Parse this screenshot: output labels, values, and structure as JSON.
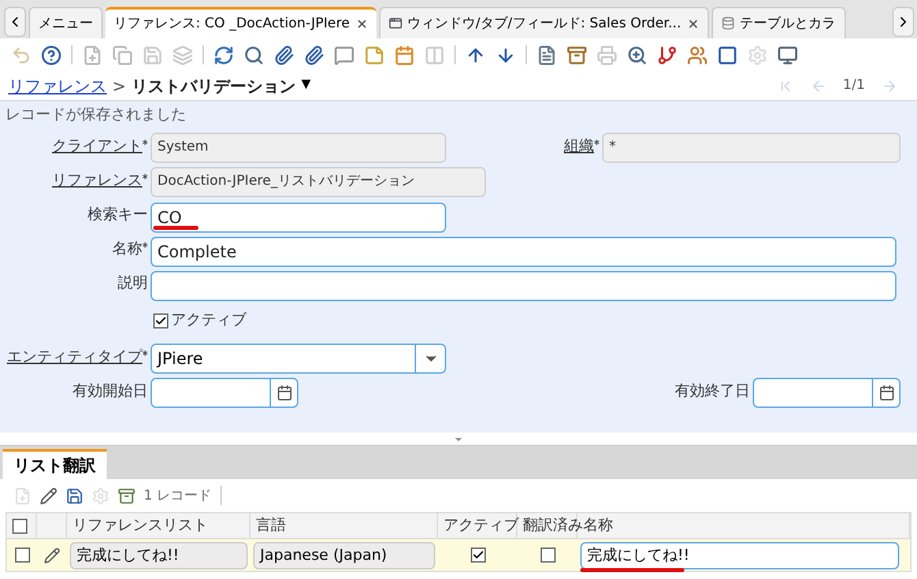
{
  "tabs": [
    {
      "label": "メニュー",
      "selected": false,
      "closable": false
    },
    {
      "label": "リファレンス: CO _DocAction-JPIere",
      "selected": true,
      "closable": true
    },
    {
      "label": "ウィンドウ/タブ/フィールド: Sales Order...",
      "selected": false,
      "closable": true
    },
    {
      "label": "テーブルとカラ",
      "selected": false,
      "closable": false
    }
  ],
  "breadcrumb": {
    "link": "リファレンス",
    "separator": ">",
    "current": "リストバリデーション",
    "caret": "▼",
    "paging": "1/1"
  },
  "status": "レコードが保存されました",
  "form": [
    {
      "fields": [
        {
          "kind": "readonly",
          "label": "クライアント",
          "link": true,
          "required": true,
          "value": "System"
        },
        {
          "kind": "readonly",
          "label": "組織",
          "link": true,
          "required": true,
          "value": "*"
        }
      ]
    },
    {
      "fields": [
        {
          "kind": "readonly",
          "label": "リファレンス",
          "link": true,
          "required": true,
          "value": "DocAction-JPIere_リストバリデーション"
        }
      ]
    },
    {
      "fields": [
        {
          "kind": "text",
          "label": "検索キー",
          "link": false,
          "required": false,
          "value": "CO",
          "highlighted": true
        }
      ]
    },
    {
      "fields": [
        {
          "kind": "text",
          "label": "名称",
          "link": false,
          "required": true,
          "value": "Complete",
          "highlighted": false
        }
      ]
    },
    {
      "fields": [
        {
          "kind": "text",
          "label": "説明",
          "link": false,
          "required": false,
          "highlighted": false
        }
      ]
    },
    {
      "fields": [
        {
          "kind": "checkbox",
          "label": "アクティブ",
          "checked": true
        }
      ]
    },
    {
      "fields": [
        {
          "kind": "select",
          "label": "エンティティタイプ",
          "link": true,
          "required": true,
          "value": "JPiere"
        }
      ]
    },
    {
      "fields": [
        {
          "kind": "date",
          "label": "有効開始日",
          "link": false,
          "required": false
        },
        {
          "kind": "date",
          "label": "有効終了日",
          "link": false,
          "required": false
        }
      ]
    }
  ],
  "detail": {
    "select_all_checked": false,
    "tabs": [
      {
        "label": "リスト翻訳",
        "selected": true
      }
    ],
    "record_count": "1 レコード",
    "columns": [
      {
        "kind": "select"
      },
      {
        "kind": "edit"
      },
      {
        "kind": "text",
        "label": "リファレンスリスト"
      },
      {
        "kind": "text",
        "label": "言語"
      },
      {
        "kind": "text",
        "label": "アクティブ"
      },
      {
        "kind": "text",
        "label": "翻訳済み"
      },
      {
        "kind": "text",
        "label": "名称"
      }
    ],
    "rows": [
      {
        "checked": false,
        "reference_list": "完成にしてね!!",
        "language": "Japanese (Japan)",
        "active": true,
        "translated": false,
        "name": "完成にしてね!!",
        "name_highlighted": true
      }
    ]
  }
}
